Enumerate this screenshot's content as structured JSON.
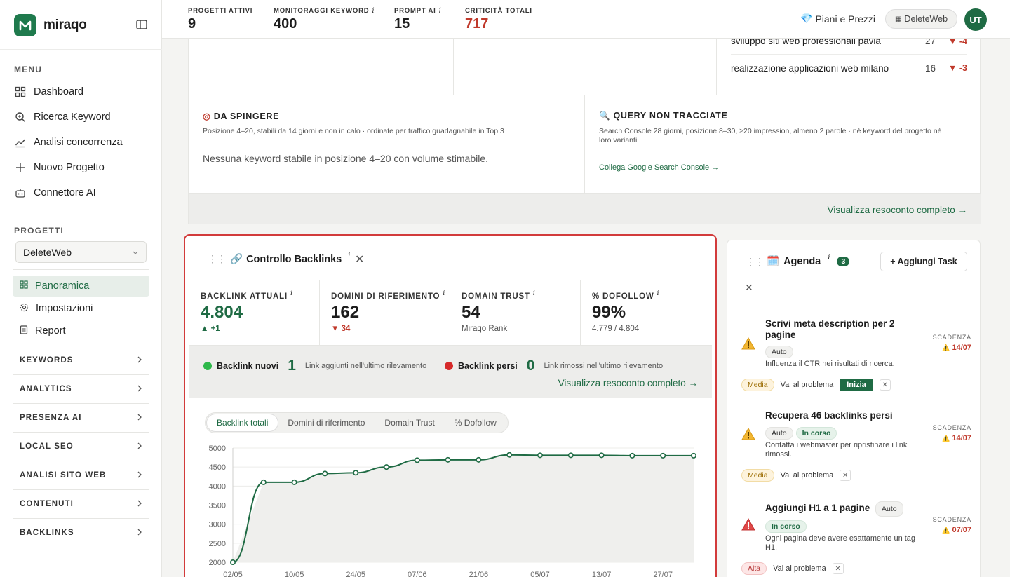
{
  "brand": {
    "name": "miraqo"
  },
  "sidebar": {
    "menu_label": "MENU",
    "menu": [
      {
        "label": "Dashboard"
      },
      {
        "label": "Ricerca Keyword"
      },
      {
        "label": "Analisi concorrenza"
      },
      {
        "label": "Nuovo Progetto"
      },
      {
        "label": "Connettore AI"
      }
    ],
    "projects_label": "PROGETTI",
    "project_selected": "DeleteWeb",
    "project_items": [
      {
        "label": "Panoramica"
      },
      {
        "label": "Impostazioni"
      },
      {
        "label": "Report"
      }
    ],
    "groups": [
      "KEYWORDS",
      "ANALYTICS",
      "PRESENZA AI",
      "LOCAL SEO",
      "ANALISI SITO WEB",
      "CONTENUTI",
      "BACKLINKS"
    ]
  },
  "topbar": {
    "stats": [
      {
        "label": "PROGETTI ATTIVI",
        "value": "9",
        "info": ""
      },
      {
        "label": "MONITORAGGI KEYWORD",
        "value": "400",
        "info": "i"
      },
      {
        "label": "PROMPT AI",
        "value": "15",
        "info": "i"
      },
      {
        "label": "CRITICITÀ TOTALI",
        "value": "717",
        "info": ""
      }
    ],
    "plans_label": "Piani e Prezzi",
    "project_pill": "DeleteWeb",
    "avatar": "UT",
    "critical_color": "#c0392b"
  },
  "upper": {
    "keywords": [
      {
        "name": "sviluppo siti web professionali pavia",
        "pos": "27",
        "delta": "-4"
      },
      {
        "name": "realizzazione applicazioni web milano",
        "pos": "16",
        "delta": "-3"
      }
    ],
    "push": {
      "title": "DA SPINGERE",
      "subtitle": "Posizione 4–20, stabili da 14 giorni e non in calo · ordinate per traffico guadagnabile in Top 3",
      "empty": "Nessuna keyword stabile in posizione 4–20 con volume stimabile."
    },
    "query": {
      "title": "QUERY NON TRACCIATE",
      "subtitle": "Search Console 28 giorni, posizione 8–30, ≥20 impression, almeno 2 parole · né keyword del progetto né loro varianti",
      "link": "Collega Google Search Console →"
    },
    "footer_link": "Visualizza resoconto completo →"
  },
  "backlinks": {
    "title": "Controllo Backlinks",
    "info": "i",
    "kpis": [
      {
        "label": "BACKLINK ATTUALI",
        "value": "4.804",
        "sub": "▲ +1"
      },
      {
        "label": "DOMINI DI RIFERIMENTO",
        "value": "162",
        "sub": "▼ 34"
      },
      {
        "label": "DOMAIN TRUST",
        "value": "54",
        "sub": "Miraqo Rank"
      },
      {
        "label": "% DOFOLLOW",
        "value": "99%",
        "sub": "4.779 / 4.804"
      }
    ],
    "new_label": "Backlink nuovi",
    "new_count": "1",
    "new_desc": "Link aggiunti nell'ultimo rilevamento",
    "lost_label": "Backlink persi",
    "lost_count": "0",
    "lost_desc": "Link rimossi nell'ultimo rilevamento",
    "report_link": "Visualizza resoconto completo →",
    "tabs": [
      "Backlink totali",
      "Domini di riferimento",
      "Domain Trust",
      "% Dofollow"
    ],
    "active_tab": 0,
    "accent": "#1f6b44"
  },
  "chart_data": {
    "type": "line",
    "title": "",
    "xlabel": "",
    "ylabel": "",
    "ylim": [
      2000,
      5000
    ],
    "yticks": [
      2000,
      2500,
      3000,
      3500,
      4000,
      4500,
      5000
    ],
    "x_ticks": [
      "02/05",
      "10/05",
      "24/05",
      "07/06",
      "21/06",
      "05/07",
      "13/07",
      "27/07"
    ],
    "points_x": [
      0,
      1,
      2,
      3,
      4,
      5,
      6,
      7,
      8,
      9,
      10,
      11,
      12,
      13,
      14,
      15
    ],
    "values": [
      2000,
      4100,
      4100,
      4330,
      4350,
      4500,
      4680,
      4690,
      4690,
      4820,
      4810,
      4810,
      4810,
      4800,
      4800,
      4800
    ],
    "grid": "horizontal",
    "line_color": "#1f6b44"
  },
  "agenda": {
    "title": "Agenda",
    "info": "i",
    "count": "3",
    "add_label": "+ Aggiungi Task",
    "due_label": "SCADENZA",
    "tasks": [
      {
        "title": "Scrivi meta description per 2 pagine",
        "chips": [
          "Auto"
        ],
        "desc": "Influenza il CTR nei risultati di ricerca.",
        "due": "14/07",
        "priority": "Media",
        "action": "Vai al problema",
        "start": "Inizia"
      },
      {
        "title": "Recupera 46 backlinks persi",
        "chips": [
          "Auto",
          "In corso"
        ],
        "desc": "Contatta i webmaster per ripristinare i link rimossi.",
        "due": "14/07",
        "priority": "Media",
        "action": "Vai al problema"
      },
      {
        "title": "Aggiungi H1 a 1 pagine",
        "chips": [
          "Auto",
          "In corso"
        ],
        "desc": "Ogni pagina deve avere esattamente un tag H1.",
        "due": "07/07",
        "priority": "Alta",
        "action": "Vai al problema"
      }
    ]
  }
}
